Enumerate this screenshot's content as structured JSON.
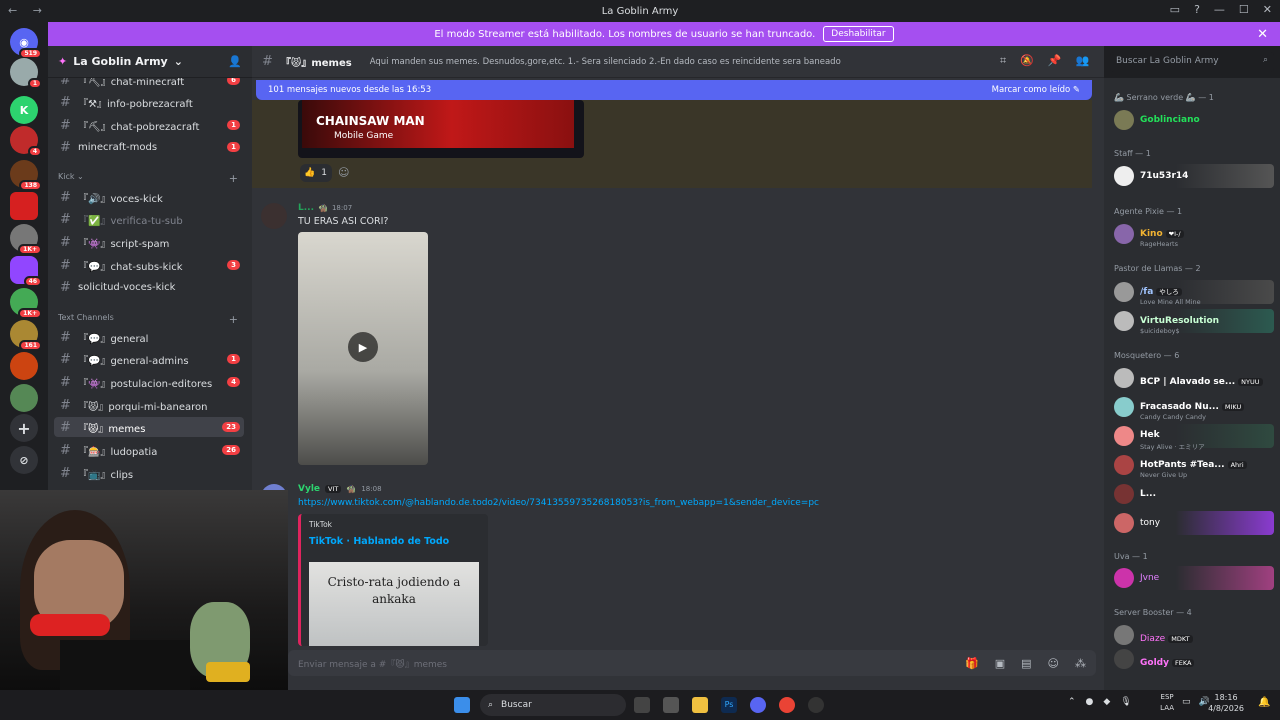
{
  "window": {
    "title": "La Goblin Army"
  },
  "banner": {
    "text": "El modo Streamer está habilitado. Los nombres de usuario se han truncado.",
    "button": "Deshabilitar"
  },
  "servers": [
    {
      "badge": "519"
    },
    {
      "badge": "1"
    },
    {
      "badge": ""
    },
    {
      "badge": "4"
    },
    {
      "badge": "138"
    },
    {
      "badge": ""
    },
    {
      "badge": "1K+"
    },
    {
      "badge": "46"
    },
    {
      "badge": "1K+"
    },
    {
      "badge": "161"
    },
    {
      "badge": ""
    },
    {
      "badge": ""
    }
  ],
  "server": {
    "name": "La Goblin Army"
  },
  "channels": {
    "top": [
      {
        "label": "『⛏』chat-minecraft",
        "count": "6"
      },
      {
        "label": "『⚒』info-pobrezacraft",
        "count": ""
      },
      {
        "label": "『⛏』chat-pobrezacraft",
        "count": "1"
      },
      {
        "label": "minecraft-mods",
        "count": "1"
      }
    ],
    "kick_category": "Kick",
    "kick": [
      {
        "label": "『🔊』voces-kick",
        "count": ""
      },
      {
        "label": "『✅』verifica-tu-sub",
        "count": ""
      },
      {
        "label": "『👾』script-spam",
        "count": ""
      },
      {
        "label": "『💬』chat-subs-kick",
        "count": "3"
      },
      {
        "label": "solicitud-voces-kick",
        "count": ""
      }
    ],
    "text_category": "Text Channels",
    "text": [
      {
        "label": "『💬』general",
        "count": ""
      },
      {
        "label": "『💬』general-admins",
        "count": "1"
      },
      {
        "label": "『👾』postulacion-editores",
        "count": "4"
      },
      {
        "label": "『😾』porqui-mi-banearon",
        "count": ""
      },
      {
        "label": "『😾』memes",
        "count": "23"
      },
      {
        "label": "『🎰』ludopatia",
        "count": "26"
      },
      {
        "label": "『📺』clips",
        "count": ""
      }
    ]
  },
  "header": {
    "channel": "『😾』memes",
    "topic": "Aqui manden sus memes. Desnudos,gore,etc. 1.- Sera silenciado 2.-En dado caso es reincidente sera baneado",
    "search_placeholder": "Buscar La Goblin Army"
  },
  "newmsg": {
    "text": "101 mensajes nuevos desde las 16:53",
    "action": "Marcar como leído"
  },
  "messages": {
    "thumb": {
      "title": "CHAINSAW MAN",
      "subtitle": "Mobile Game"
    },
    "reaction": {
      "count": "1"
    },
    "m1": {
      "user": "L...",
      "time": "18:07",
      "text": "TU ERAS ASI CORI?"
    },
    "m2": {
      "user": "Vyle",
      "role": "VIT",
      "time": "18:08",
      "link": "https://www.tiktok.com/@hablando.de.todo2/video/7341355973526818053?is_from_webapp=1&sender_device=pc",
      "embed_provider": "TikTok",
      "embed_title": "TikTok · Hablando de Todo",
      "embed_image_text": "Cristo-rata jodiendo a ankaka"
    }
  },
  "composer": {
    "placeholder": "Enviar mensaje a #『😾』memes"
  },
  "members": {
    "groups": [
      {
        "title": "🦾 Serrano verde 🦾 — 1",
        "members": [
          {
            "name": "Goblinciano",
            "sub": "",
            "tag": "",
            "color": "#23e05a"
          }
        ]
      },
      {
        "title": "Staff — 1",
        "members": [
          {
            "name": "71u53r14",
            "sub": "",
            "tag": "",
            "color": "#ffffff"
          }
        ]
      },
      {
        "title": "Agente Pixie — 1",
        "members": [
          {
            "name": "Kino",
            "sub": "RageHearts",
            "tag": "❤I-/",
            "color": "#f0b232"
          }
        ]
      },
      {
        "title": "Pastor de Llamas — 2",
        "members": [
          {
            "name": "/fa",
            "sub": "Love Mine All Mine",
            "tag": "やしろ",
            "color": "#a0c4ff"
          },
          {
            "name": "VirtuResolution",
            "sub": "$uicideboy$",
            "tag": "",
            "color": "#c8ffd4"
          }
        ]
      },
      {
        "title": "Mosquetero — 6",
        "members": [
          {
            "name": "BCP | Alavado se...",
            "sub": "",
            "tag": "NYUU",
            "color": "#ffffff"
          },
          {
            "name": "Fracasado Nu...",
            "sub": "Candy Candy Candy",
            "tag": "MIKU",
            "color": "#ffffff"
          },
          {
            "name": "Hek",
            "sub": "Stay Alive · エミリア",
            "tag": "",
            "color": "#ffffff"
          },
          {
            "name": "HotPants #Tea...",
            "sub": "Never Give Up",
            "tag": "Ahri",
            "color": "#ffffff"
          },
          {
            "name": "L...",
            "sub": "",
            "tag": "",
            "color": "#ffffff"
          },
          {
            "name": "tony",
            "sub": "",
            "tag": "",
            "color": "#ffffff"
          }
        ]
      },
      {
        "title": "Uva — 1",
        "members": [
          {
            "name": "Jvne",
            "sub": "",
            "tag": "",
            "color": "#e080ff"
          }
        ]
      },
      {
        "title": "Server Booster — 4",
        "members": [
          {
            "name": "Diaze",
            "sub": "",
            "tag": "MDKT",
            "color": "#ff73fa"
          },
          {
            "name": "Goldy",
            "sub": "",
            "tag": "FEKA",
            "color": "#ff73fa"
          }
        ]
      }
    ]
  },
  "taskbar": {
    "search": "Buscar",
    "lang1": "ESP",
    "lang2": "LAA",
    "time": "18:16",
    "date": "4/8/2026"
  }
}
